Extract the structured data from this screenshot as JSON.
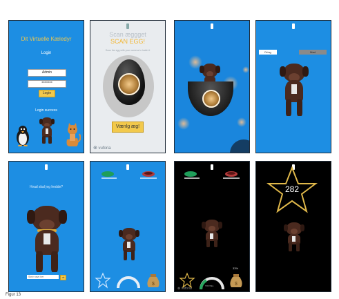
{
  "screens": {
    "login": {
      "title": "Dit Virtuelle Kæledyr",
      "login_heading": "Login",
      "username_value": "Admin",
      "password_value": "********",
      "login_button": "Login",
      "status": "Login success"
    },
    "scan": {
      "heading": "Scan æggget",
      "scan_label": "SCAN EGG!",
      "instruction": "Scan the egg with your camera to hatch it",
      "select_button": "Vænlg æg!",
      "watermark": "vuforia"
    },
    "room": {
      "button_left": "Dring",
      "button_right": "Mad"
    },
    "name": {
      "prompt": "Hvad skal jeg hedde?",
      "name_placeholder": "Skriv navn her",
      "ok_button": "ok"
    },
    "dark": {
      "percent": "33%",
      "gauge_label": "TRIVSEL",
      "watermark": "vuforia"
    },
    "score": {
      "value": "282"
    }
  },
  "caption": "Figur 13"
}
